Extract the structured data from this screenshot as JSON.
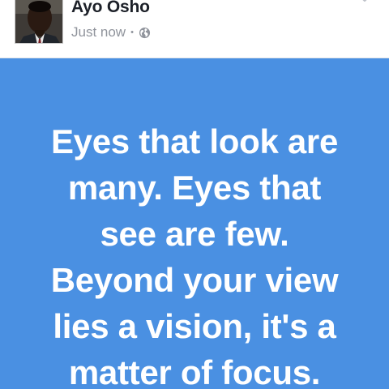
{
  "post": {
    "author_name": "Ayo Osho",
    "timestamp": "Just now",
    "separator": "•",
    "privacy_icon": "globe-icon",
    "menu_icon": "chevron-down-icon",
    "avatar": "profile-photo"
  },
  "quote": {
    "background_color": "#4a90e2",
    "text_color": "#ffffff",
    "lines": [
      "Eyes that look are",
      "many. Eyes that",
      "see are few.",
      "Beyond your view",
      "lies a vision, it's a",
      "matter of focus."
    ]
  }
}
